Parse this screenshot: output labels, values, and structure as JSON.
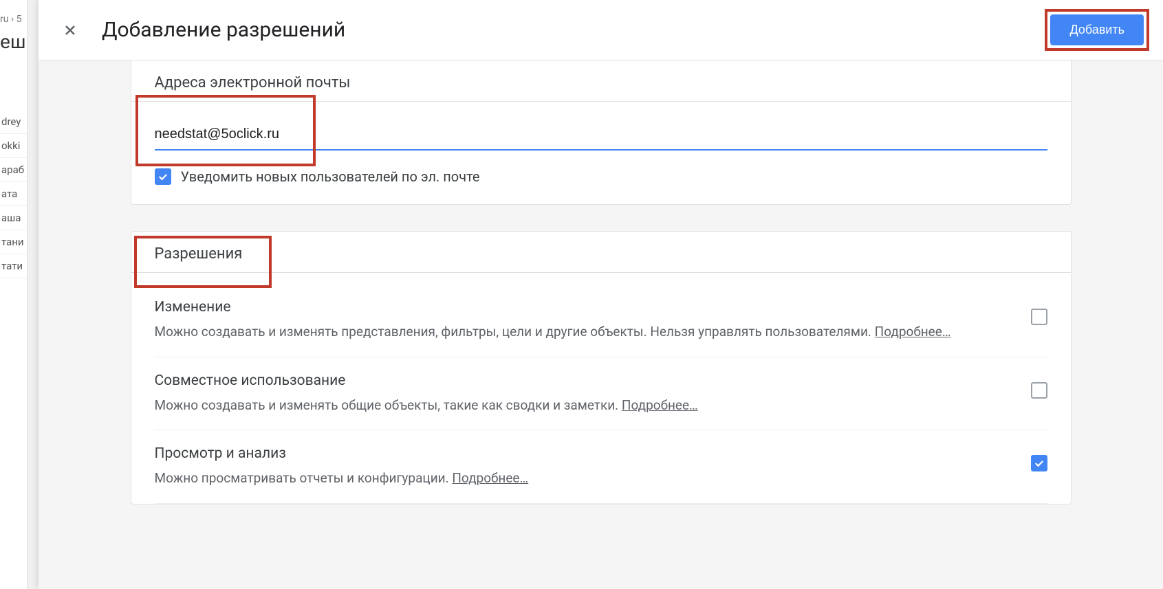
{
  "background": {
    "crumb": "ru › 5",
    "title_fragment": "еш",
    "sidebar_items": [
      "drey",
      "okki",
      "араб",
      "ата",
      "аша",
      "тани",
      "тати"
    ]
  },
  "header": {
    "title": "Добавление разрешений",
    "add_button": "Добавить"
  },
  "email_section": {
    "title": "Адреса электронной почты",
    "value": "needstat@5oclick.ru",
    "notify_label": "Уведомить новых пользователей по эл. почте",
    "notify_checked": true
  },
  "permissions_section": {
    "title": "Разрешения",
    "items": [
      {
        "name": "Изменение",
        "desc": "Можно создавать и изменять представления, фильтры, цели и другие объекты. Нельзя управлять пользователями. ",
        "learn_more": "Подробнее…",
        "checked": false
      },
      {
        "name": "Совместное использование",
        "desc": "Можно создавать и изменять общие объекты, такие как сводки и заметки. ",
        "learn_more": "Подробнее…",
        "checked": false
      },
      {
        "name": "Просмотр и анализ",
        "desc": "Можно просматривать отчеты и конфигурации. ",
        "learn_more": "Подробнее…",
        "checked": true
      }
    ]
  }
}
